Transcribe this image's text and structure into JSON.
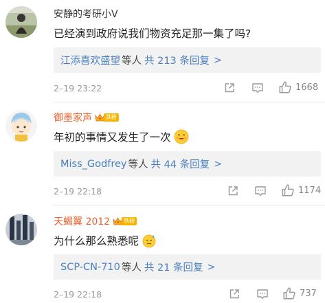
{
  "comments": [
    {
      "username": "安静的考研小V",
      "text": "已经演到政府说我们物资充足那一集了吗?",
      "reply": {
        "users": "江添喜欢盛望",
        "mid": "等人",
        "total": "共 213 条回复",
        "arrow": ">"
      },
      "time": "2–19 23:22",
      "likes": "1668",
      "username_color": "#333333"
    },
    {
      "username": "御墨家声",
      "badge": "铁粉",
      "text": "年初的事情又发生了一次",
      "reply": {
        "users": "Miss_Godfrey",
        "mid": "等人",
        "total": "共 44 条回复",
        "arrow": ">"
      },
      "time": "2–19 22:18",
      "likes": "1174",
      "username_color": "#e8612c"
    },
    {
      "username": "天蝎翼 2012",
      "badge": "铁粉",
      "text": "为什么那么熟悉呢",
      "reply": {
        "users": "SCP-CN-710",
        "mid": "等人",
        "total": "共 21 条回复",
        "arrow": ">"
      },
      "time": "2–19 22:18",
      "likes": "737",
      "username_color": "#e8612c"
    }
  ],
  "icons": [
    "share-icon",
    "reply-icon",
    "like-icon",
    "crown-icon",
    "emoji-drool-icon",
    "emoji-sweat-icon"
  ]
}
